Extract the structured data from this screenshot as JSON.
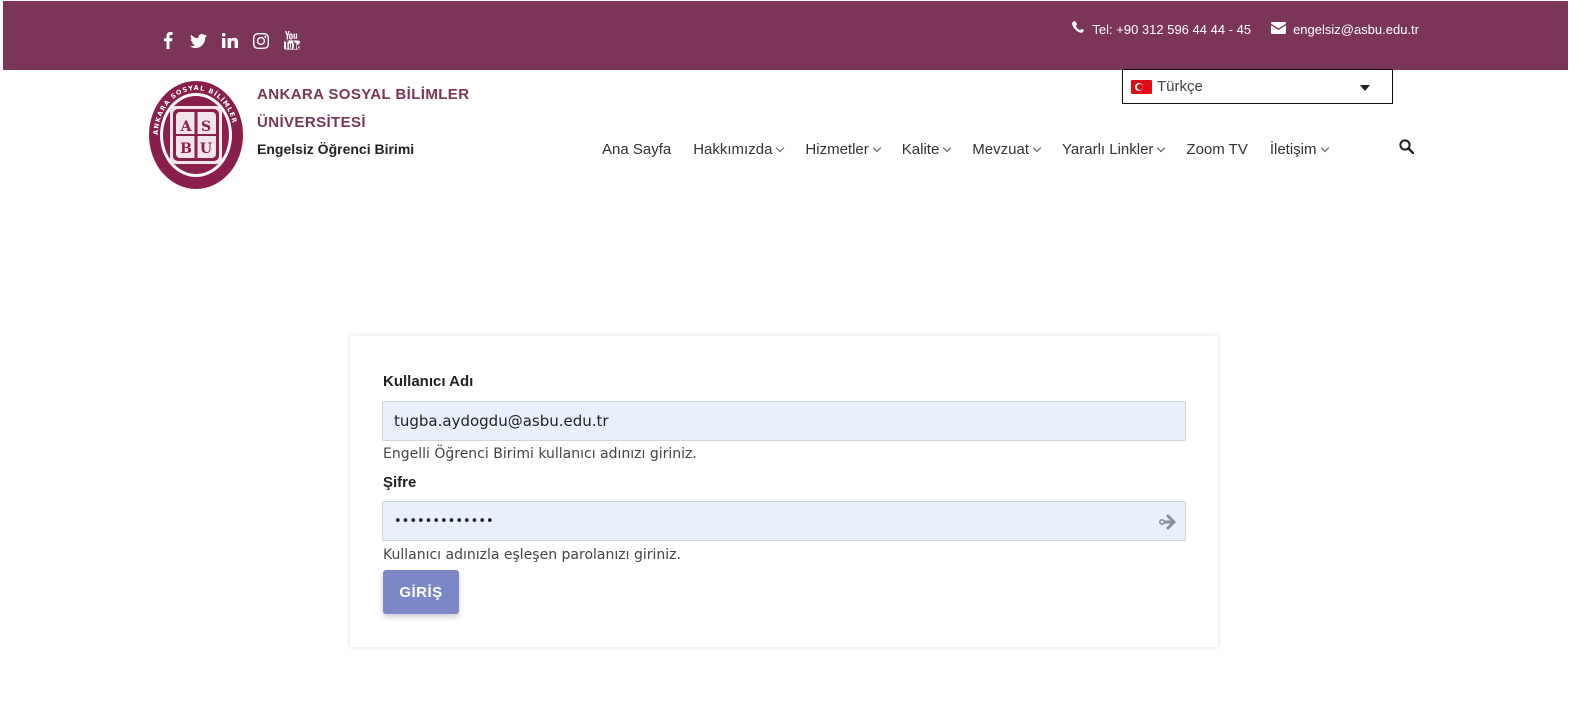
{
  "topbar": {
    "social": [
      "facebook-icon",
      "twitter-icon",
      "linkedin-icon",
      "instagram-icon",
      "youtube-icon"
    ],
    "phone": "Tel: +90 312 596 44 44 - 45",
    "email": "engelsiz@asbu.edu.tr",
    "bg_color": "#7b3559"
  },
  "brand": {
    "line1": "ANKARA SOSYAL BİLİMLER",
    "line2": "ÜNİVERSİTESİ",
    "unit": "Engelsiz Öğrenci Birimi",
    "logo_letters": "AS BU",
    "logo_ring_text": "ANKARA SOSYAL BİLİMLER ÜNİVERSİTESİ"
  },
  "language": {
    "selected": "Türkçe"
  },
  "nav": {
    "items": [
      {
        "label": "Ana Sayfa",
        "dropdown": false
      },
      {
        "label": "Hakkımızda",
        "dropdown": true
      },
      {
        "label": "Hizmetler",
        "dropdown": true
      },
      {
        "label": "Kalite",
        "dropdown": true
      },
      {
        "label": "Mevzuat",
        "dropdown": true
      },
      {
        "label": "Yararlı Linkler",
        "dropdown": true
      },
      {
        "label": "Zoom TV",
        "dropdown": false
      },
      {
        "label": "İletişim",
        "dropdown": true
      }
    ]
  },
  "login": {
    "username_label": "Kullanıcı Adı",
    "username_value": "tugba.aydogdu@asbu.edu.tr",
    "username_help": "Engelli Öğrenci Birimi kullanıcı adınızı giriniz.",
    "password_label": "Şifre",
    "password_value": "•••••••••••••",
    "password_help": "Kullanıcı adınızla eşleşen parolanızı giriniz.",
    "submit_label": "GİRİŞ",
    "button_color": "#7b87c6",
    "input_bg": "#e8f0fe"
  }
}
